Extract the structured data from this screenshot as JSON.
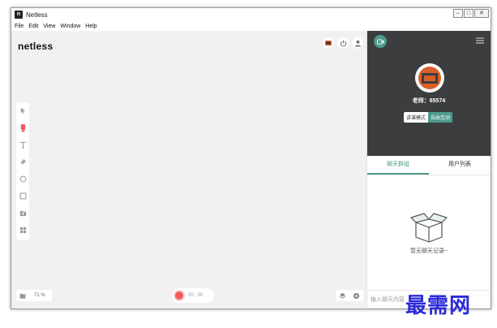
{
  "window": {
    "title": "Netless",
    "app_icon_glyph": "n"
  },
  "menubar": [
    "File",
    "Edit",
    "View",
    "Window",
    "Help"
  ],
  "canvas": {
    "logo": "netless",
    "zoom": "71 %",
    "recording_time": "00 : 00"
  },
  "sidebar": {
    "teacher_label": "老师：65574",
    "mode_lecture": "讲课模式",
    "mode_free": "自由互动",
    "tabs": [
      "聊天群组",
      "用户列表"
    ],
    "empty_text": "暂无聊天记录~",
    "chat_placeholder": "输入聊天内容",
    "accent_color": "#4f9a8c",
    "video_bg": "#3b3d3e"
  },
  "watermark": "最需网",
  "colors": {
    "record": "#f25a5a",
    "brand_orange": "#d95f2b"
  }
}
